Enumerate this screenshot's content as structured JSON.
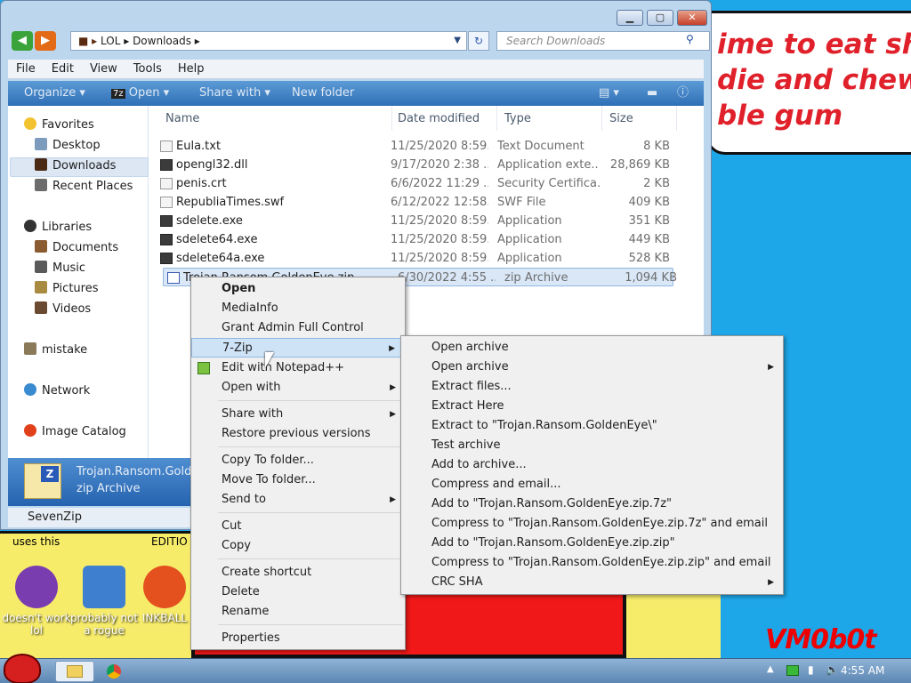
{
  "wallpaper": {
    "bubble_text": "ime to eat shit\ndie and chew\nble gum",
    "watermark": "VM0b0t",
    "snippet_left": "uses this",
    "snippet_mid": "EDITIO"
  },
  "desktop_icons": [
    {
      "label": "doesn't work lol",
      "color": "#7a3db0"
    },
    {
      "label": "probably not a rogue",
      "color": "#3e7fcf"
    },
    {
      "label": "INKBALL",
      "color": "#e4511e"
    }
  ],
  "window": {
    "address": {
      "path": [
        "LOL",
        "Downloads"
      ]
    },
    "search_placeholder": "Search Downloads",
    "menubar": [
      "File",
      "Edit",
      "View",
      "Tools",
      "Help"
    ],
    "commands": {
      "organize": "Organize",
      "open": "Open",
      "share": "Share with",
      "new_folder": "New folder"
    },
    "columns": {
      "name": "Name",
      "date": "Date modified",
      "type": "Type",
      "size": "Size"
    },
    "nav": {
      "favorites": "Favorites",
      "desktop": "Desktop",
      "downloads": "Downloads",
      "recent": "Recent Places",
      "libraries": "Libraries",
      "documents": "Documents",
      "music": "Music",
      "pictures": "Pictures",
      "videos": "Videos",
      "mistake": "mistake",
      "network": "Network",
      "image_catalog": "Image Catalog"
    },
    "files": [
      {
        "name": "Eula.txt",
        "date": "11/25/2020 8:59...",
        "type": "Text Document",
        "size": "8 KB"
      },
      {
        "name": "opengl32.dll",
        "date": "9/17/2020 2:38 ...",
        "type": "Application exte...",
        "size": "28,869 KB"
      },
      {
        "name": "penis.crt",
        "date": "6/6/2022 11:29 ...",
        "type": "Security Certifica...",
        "size": "2 KB"
      },
      {
        "name": "RepubliaTimes.swf",
        "date": "6/12/2022 12:58...",
        "type": "SWF File",
        "size": "409 KB"
      },
      {
        "name": "sdelete.exe",
        "date": "11/25/2020 8:59...",
        "type": "Application",
        "size": "351 KB"
      },
      {
        "name": "sdelete64.exe",
        "date": "11/25/2020 8:59...",
        "type": "Application",
        "size": "449 KB"
      },
      {
        "name": "sdelete64a.exe",
        "date": "11/25/2020 8:59...",
        "type": "Application",
        "size": "528 KB"
      },
      {
        "name": "Trojan.Ransom.GoldenEye.zip",
        "date": "6/30/2022 4:55 ...",
        "type": "zip Archive",
        "size": "1,094 KB"
      }
    ],
    "details": {
      "name": "Trojan.Ransom.Golden",
      "type": "zip Archive"
    },
    "status": "SevenZip"
  },
  "context_menu": {
    "items": [
      "Open",
      "MediaInfo",
      "Grant Admin Full Control",
      "7-Zip",
      "Edit with Notepad++",
      "Open with",
      "Share with",
      "Restore previous versions",
      "Copy To folder...",
      "Move To folder...",
      "Send to",
      "Cut",
      "Copy",
      "Create shortcut",
      "Delete",
      "Rename",
      "Properties"
    ]
  },
  "submenu_7zip": {
    "items": [
      "Open archive",
      "Open archive",
      "Extract files...",
      "Extract Here",
      "Extract to \"Trojan.Ransom.GoldenEye\\\"",
      "Test archive",
      "Add to archive...",
      "Compress and email...",
      "Add to \"Trojan.Ransom.GoldenEye.zip.7z\"",
      "Compress to \"Trojan.Ransom.GoldenEye.zip.7z\" and email",
      "Add to \"Trojan.Ransom.GoldenEye.zip.zip\"",
      "Compress to \"Trojan.Ransom.GoldenEye.zip.zip\" and email",
      "CRC SHA"
    ]
  },
  "taskbar": {
    "clock": "4:55 AM"
  }
}
